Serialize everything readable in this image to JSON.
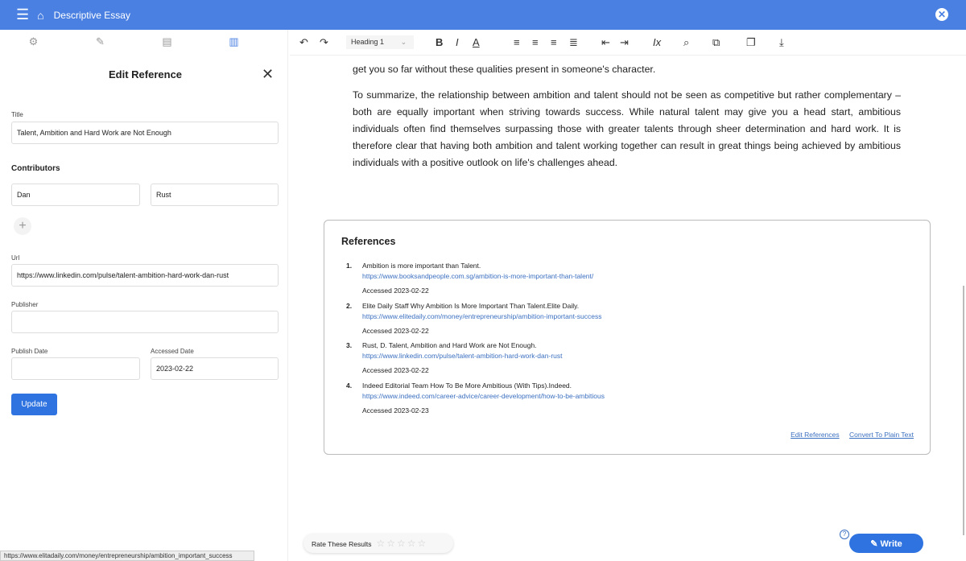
{
  "header": {
    "title": "Descriptive Essay"
  },
  "panel": {
    "title": "Edit Reference",
    "title_label": "Title",
    "title_value": "Talent, Ambition and Hard Work are Not Enough",
    "contributors_label": "Contributors",
    "contributor_first": "Dan",
    "contributor_last": "Rust",
    "url_label": "Url",
    "url_value": "https://www.linkedin.com/pulse/talent-ambition-hard-work-dan-rust",
    "publisher_label": "Publisher",
    "publisher_value": "",
    "publish_date_label": "Publish Date",
    "publish_date_value": "",
    "accessed_date_label": "Accessed Date",
    "accessed_date_value": "2023-02-22",
    "update_label": "Update"
  },
  "toolbar": {
    "heading_select": "Heading 1"
  },
  "doc": {
    "partial_line": "get you so far without these qualities present in someone's character.",
    "paragraph": "To summarize, the relationship between ambition and talent should not be seen as competitive but rather complementary – both are equally important when striving towards success. While natural talent may give you a head start, ambitious individuals often find themselves surpassing those with greater talents through sheer determination and hard work. It is therefore clear that having both ambition and talent working together can result in great things being achieved by ambitious individuals with a positive outlook on life's challenges ahead."
  },
  "references": {
    "title": "References",
    "items": [
      {
        "num": "1.",
        "text": "Ambition is more important than Talent.",
        "url": "https://www.booksandpeople.com.sg/ambition-is-more-important-than-talent/",
        "accessed": "Accessed 2023-02-22"
      },
      {
        "num": "2.",
        "text": "Elite Daily Staff Why Ambition Is More Important Than Talent.Elite Daily.",
        "url": "https://www.elitedaily.com/money/entrepreneurship/ambition-important-success",
        "accessed": "Accessed 2023-02-22"
      },
      {
        "num": "3.",
        "text": "Rust, D. Talent, Ambition and Hard Work are Not Enough.",
        "url": "https://www.linkedin.com/pulse/talent-ambition-hard-work-dan-rust",
        "accessed": "Accessed 2023-02-22"
      },
      {
        "num": "4.",
        "text": "Indeed Editorial Team How To Be More Ambitious (With Tips).Indeed.",
        "url": "https://www.indeed.com/career-advice/career-development/how-to-be-ambitious",
        "accessed": "Accessed 2023-02-23"
      }
    ],
    "edit_label": "Edit References",
    "convert_label": "Convert To Plain Text"
  },
  "status_url": "https://www.elitadaily.com/money/entrepreneurship/ambition_important_success",
  "rating": {
    "label": "Rate These Results",
    "stars": "☆☆☆☆☆",
    "value": 0
  },
  "write_label": "Write",
  "help": "?"
}
